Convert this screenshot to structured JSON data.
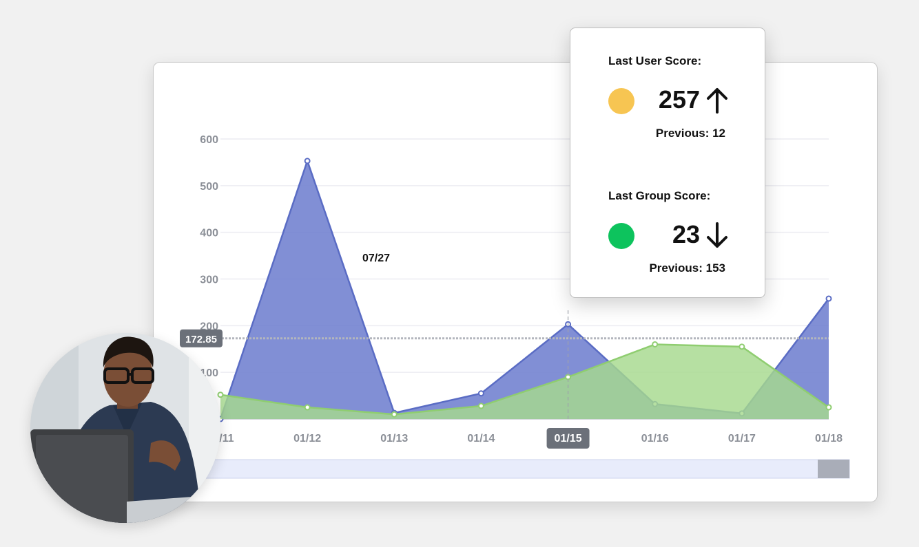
{
  "chart_data": {
    "type": "area",
    "categories": [
      "01/11",
      "01/12",
      "01/13",
      "01/14",
      "01/15",
      "01/16",
      "01/17",
      "01/18"
    ],
    "series": [
      {
        "values": [
          0,
          553,
          13,
          55,
          203,
          32,
          12,
          258
        ],
        "color": "#7080cf",
        "line_color": "#5a6cc4"
      },
      {
        "values": [
          52,
          25,
          10,
          28,
          90,
          160,
          155,
          25
        ],
        "color": "#a6d98e",
        "line_color": "#8fcd70"
      }
    ],
    "yticks": [
      100,
      200,
      300,
      400,
      500,
      600
    ],
    "ylim": [
      0,
      600
    ],
    "grid": true,
    "first_tick_label": "01/11",
    "selected_category": "01/15",
    "hover_date": "07/27",
    "crosshair_value": "172.85"
  },
  "score_panel": {
    "user": {
      "label": "Last User Score:",
      "value": "257",
      "previous": "Previous: 12",
      "trend": "up",
      "color": "#f7c552"
    },
    "group": {
      "label": "Last Group Score:",
      "value": "23",
      "previous": "Previous: 153",
      "trend": "down",
      "color": "#0dc35d"
    }
  },
  "scrollbar": {
    "position": 1.0
  }
}
